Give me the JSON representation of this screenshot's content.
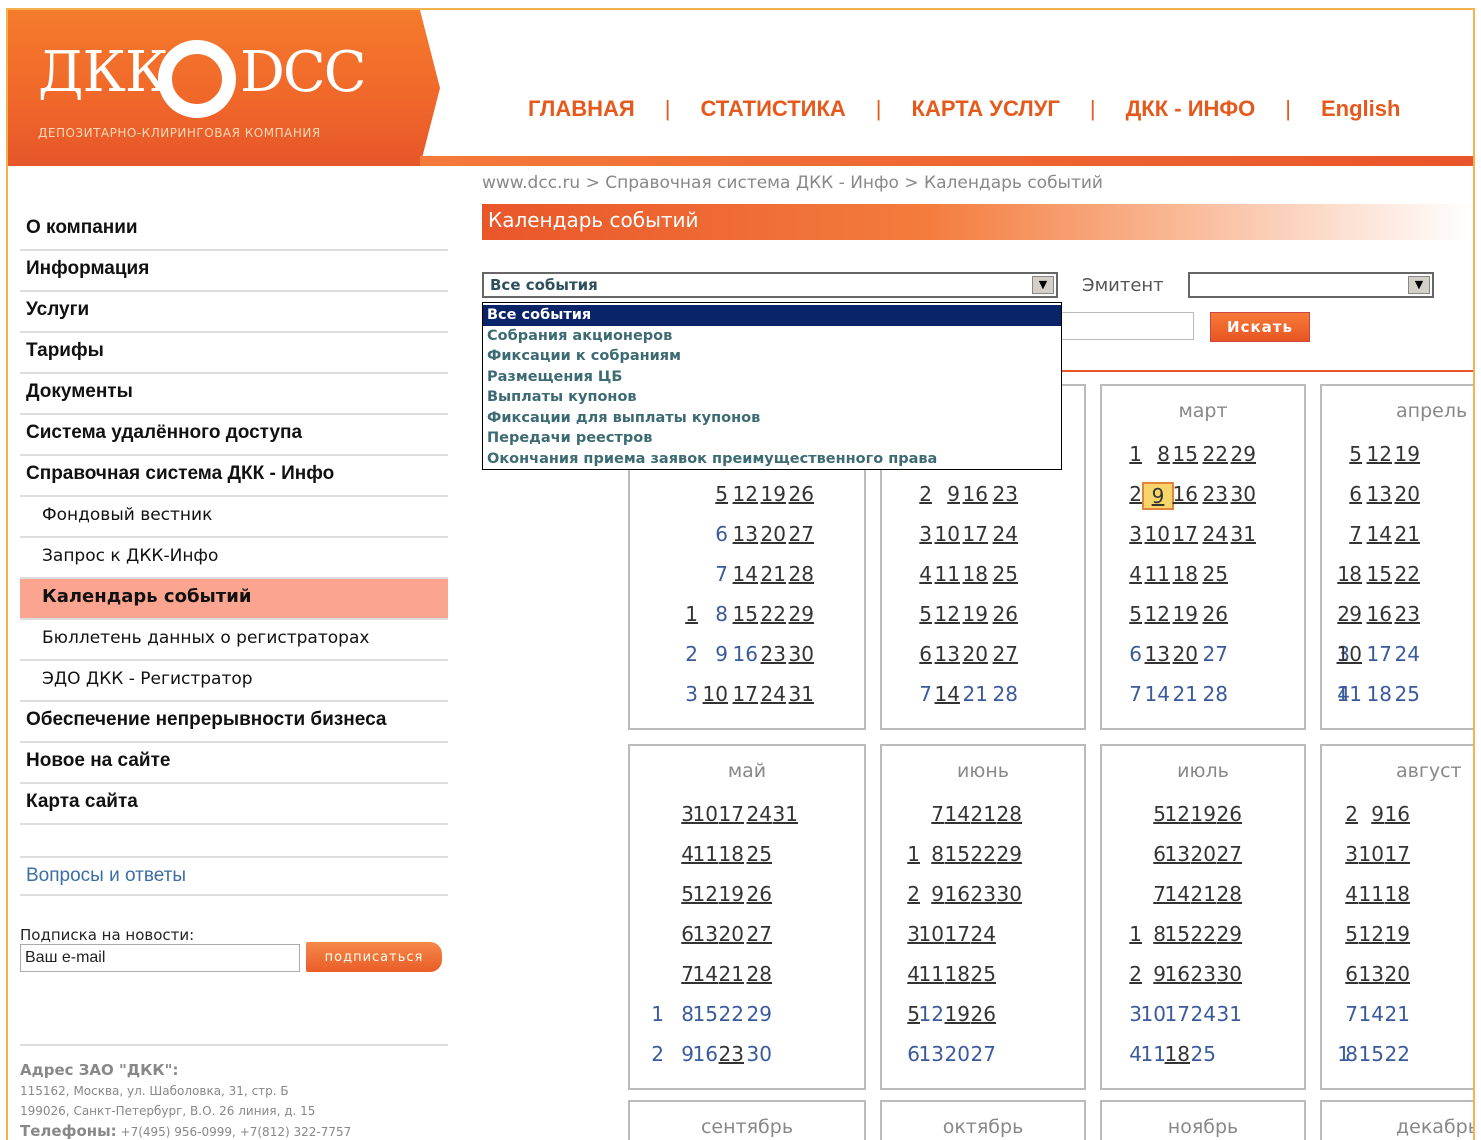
{
  "logo": {
    "left": "ДКК",
    "right": "DCC",
    "subtitle": "ДЕПОЗИТАРНО-КЛИРИНГОВАЯ КОМПАНИЯ"
  },
  "topnav": {
    "items": [
      "ГЛАВНАЯ",
      "СТАТИСТИКА",
      "КАРТА УСЛУГ",
      "ДКК - ИНФО",
      "English"
    ],
    "separator": "|"
  },
  "breadcrumb": "www.dcc.ru > Справочная система ДКК - Инфо > Календарь событий",
  "page_title": "Календарь событий",
  "sidebar": {
    "items": [
      {
        "label": "О компании",
        "level": 0
      },
      {
        "label": "Информация",
        "level": 0
      },
      {
        "label": "Услуги",
        "level": 0
      },
      {
        "label": "Тарифы",
        "level": 0
      },
      {
        "label": "Документы",
        "level": 0
      },
      {
        "label": "Система удалённого доступа",
        "level": 0
      },
      {
        "label": "Справочная система ДКК - Инфо",
        "level": 0
      },
      {
        "label": "Фондовый вестник",
        "level": 1
      },
      {
        "label": "Запрос к ДКК-Инфо",
        "level": 1
      },
      {
        "label": "Календарь событий",
        "level": 1,
        "active": true
      },
      {
        "label": "Бюллетень данных о регистраторах",
        "level": 1
      },
      {
        "label": "ЭДО ДКК - Регистратор",
        "level": 1
      },
      {
        "label": "Обеспечение непрерывности бизнеса",
        "level": 0
      },
      {
        "label": "Новое на сайте",
        "level": 0
      },
      {
        "label": "Карта сайта",
        "level": 0
      }
    ],
    "faq": "Вопросы и ответы",
    "subscribe_label": "Подписка на новости:",
    "subscribe_value": "Ваш e-mail",
    "subscribe_button": "подписаться",
    "address_title": "Адрес ЗАО \"ДКК\":",
    "address_lines": [
      "115162, Москва, ул. Шаболовка, 31, стр. Б",
      "199026, Санкт-Петербург, В.О. 26 линия, д. 15"
    ],
    "phones_label": "Телефоны:",
    "phones_value": "+7(495) 956-0999, +7(812) 322-7757"
  },
  "filters": {
    "event_selected": "Все события",
    "event_options": [
      "Все события",
      "Собрания акционеров",
      "Фиксации к собраниям",
      "Размещения ЦБ",
      "Выплаты купонов",
      "Фиксации для выплаты купонов",
      "Передачи реестров",
      "Окончания приема заявок преимущественного права"
    ],
    "emitter_label": "Эмитент",
    "emitter_value": "",
    "search_button": "Искать"
  },
  "calendar": {
    "months": [
      {
        "id": "jan",
        "name": "",
        "cols": [
          {
            "slot": 2,
            "days": [
              {
                "d": 5,
                "u": 1
              },
              {
                "d": 6,
                "u": 0
              },
              {
                "d": 7,
                "u": 0
              },
              {
                "d": 1,
                "u": 1,
                "row": 3
              },
              {
                "d": 2,
                "u": 0,
                "row": 4
              },
              {
                "d": 3,
                "u": 0,
                "row": 5
              }
            ]
          }
        ]
      },
      {
        "id": "apr",
        "name": "апрель"
      },
      {
        "id": "may",
        "name": "май"
      },
      {
        "id": "jun",
        "name": "июнь"
      },
      {
        "id": "jul",
        "name": "июль"
      },
      {
        "id": "aug",
        "name": "август"
      },
      {
        "id": "sep",
        "name": "сентябрь"
      },
      {
        "id": "oct",
        "name": "октябрь"
      },
      {
        "id": "nov",
        "name": "ноябрь"
      },
      {
        "id": "dec",
        "name": "декабрь"
      },
      {
        "id": "mar",
        "name": "март"
      }
    ]
  }
}
